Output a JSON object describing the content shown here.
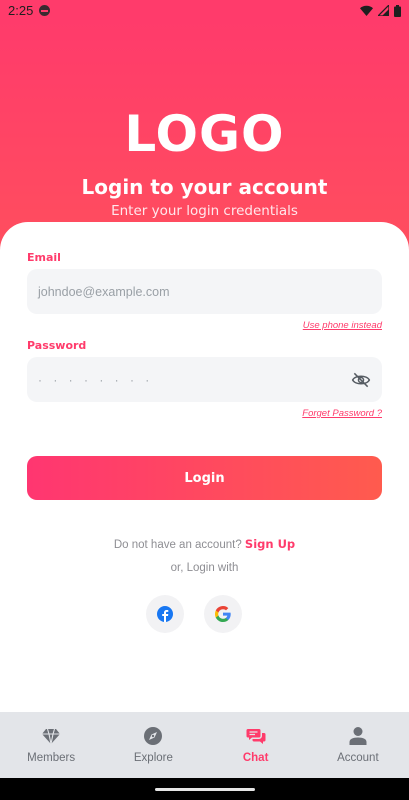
{
  "status_bar": {
    "time": "2:25"
  },
  "hero": {
    "logo": "LOGO",
    "title": "Login to your account",
    "subtitle": "Enter your login credentials"
  },
  "form": {
    "email_label": "Email",
    "email_placeholder": "johndoe@example.com",
    "use_phone_link": "Use phone instead",
    "password_label": "Password",
    "password_value": "· · · · · · · ·",
    "forgot_link": "Forget Password ?",
    "login_button": "Login",
    "signup_prompt": "Do not have an account?",
    "signup_link": "Sign Up",
    "or_login_with": "or, Login with"
  },
  "social": [
    {
      "icon": "facebook-icon"
    },
    {
      "icon": "google-icon"
    }
  ],
  "bottom_nav": {
    "items": [
      {
        "label": "Members",
        "icon": "diamond-icon"
      },
      {
        "label": "Explore",
        "icon": "compass-icon"
      },
      {
        "label": "Chat",
        "icon": "chat-icon",
        "active": true
      },
      {
        "label": "Account",
        "icon": "person-icon"
      }
    ]
  },
  "colors": {
    "brand": "#ff3b6b",
    "gradient_end": "#ff5b4e",
    "nav_background": "#e3e5e9"
  }
}
